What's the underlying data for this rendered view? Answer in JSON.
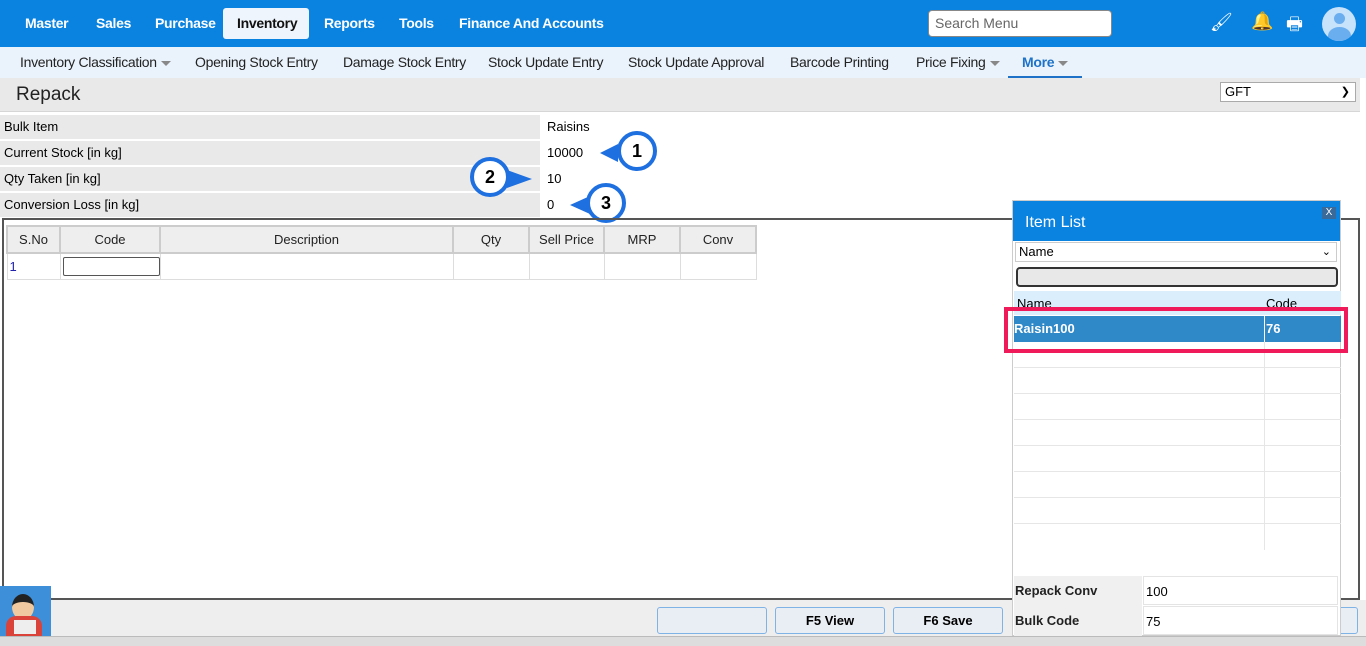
{
  "topnav": {
    "items": [
      "Master",
      "Sales",
      "Purchase",
      "Inventory",
      "Reports",
      "Tools",
      "Finance And Accounts"
    ],
    "active": "Inventory",
    "search_placeholder": "Search Menu",
    "icons": [
      "brush-icon",
      "bell-icon",
      "printer-icon",
      "user-avatar-icon"
    ]
  },
  "subnav": {
    "items": [
      "Inventory Classification",
      "Opening Stock Entry",
      "Damage Stock Entry",
      "Stock Update Entry",
      "Stock Update Approval",
      "Barcode Printing",
      "Price Fixing",
      "More"
    ]
  },
  "page": {
    "title": "Repack",
    "company_select": "GFT"
  },
  "form": [
    {
      "label": "Bulk Item",
      "value": "Raisins"
    },
    {
      "label": "Current Stock [in kg]",
      "value": "10000"
    },
    {
      "label": "Qty Taken [in kg]",
      "value": "10"
    },
    {
      "label": "Conversion Loss [in kg]",
      "value": "0"
    }
  ],
  "annotations": [
    "1",
    "2",
    "3"
  ],
  "grid": {
    "columns": [
      "S.No",
      "Code",
      "Description",
      "Qty",
      "Sell Price",
      "MRP",
      "Conv"
    ],
    "rows": [
      {
        "sno": "1",
        "code": ""
      }
    ]
  },
  "buttons": {
    "blank": "",
    "view": "F5 View",
    "save": "F6 Save"
  },
  "item_list": {
    "title": "Item List",
    "close": "X",
    "search_by": "Name",
    "search_value": "",
    "columns": [
      "Name",
      "Code"
    ],
    "rows": [
      {
        "name": "Raisin100",
        "code": "76"
      }
    ],
    "repack_conv_label": "Repack Conv",
    "repack_conv": "100",
    "bulk_code_label": "Bulk Code",
    "bulk_code": "75"
  },
  "colors": {
    "brand": "#0a83e0",
    "highlight": "#ee1a5a",
    "annotation": "#1e6fe0",
    "selected_row": "#2f88c8"
  }
}
